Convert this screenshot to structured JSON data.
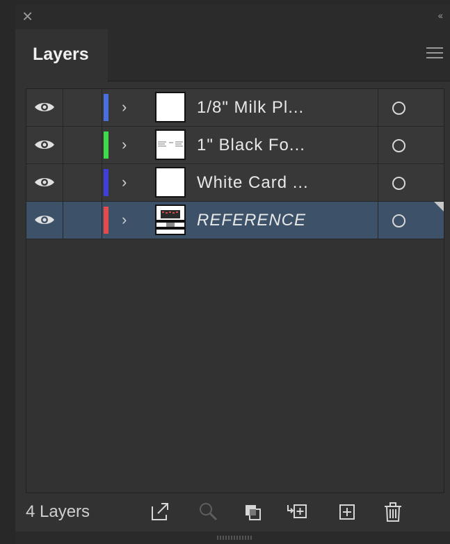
{
  "panel": {
    "tab_title": "Layers",
    "layer_count_label": "4 Layers"
  },
  "layers": [
    {
      "name": "1/8\" Milk Pl...",
      "color": "#4a6fe0",
      "selected": false,
      "thumb": "blank"
    },
    {
      "name": "1\" Black Fo...",
      "color": "#3ddc4a",
      "selected": false,
      "thumb": "lines"
    },
    {
      "name": "White Card ...",
      "color": "#3f3ed8",
      "selected": false,
      "thumb": "blank"
    },
    {
      "name": "REFERENCE",
      "color": "#e54b4b",
      "selected": true,
      "thumb": "image"
    }
  ],
  "colors": {
    "panel_bg": "#323232",
    "row_bg": "#383838",
    "selected_row_bg": "#3d5269"
  },
  "icons": [
    "close-icon",
    "collapse-icon",
    "panel-menu-icon",
    "visibility-icon",
    "expand-chevron-icon",
    "target-icon",
    "collect-export-icon",
    "locate-object-icon",
    "make-clipping-mask-icon",
    "create-sublayer-icon",
    "new-layer-icon",
    "delete-icon"
  ]
}
